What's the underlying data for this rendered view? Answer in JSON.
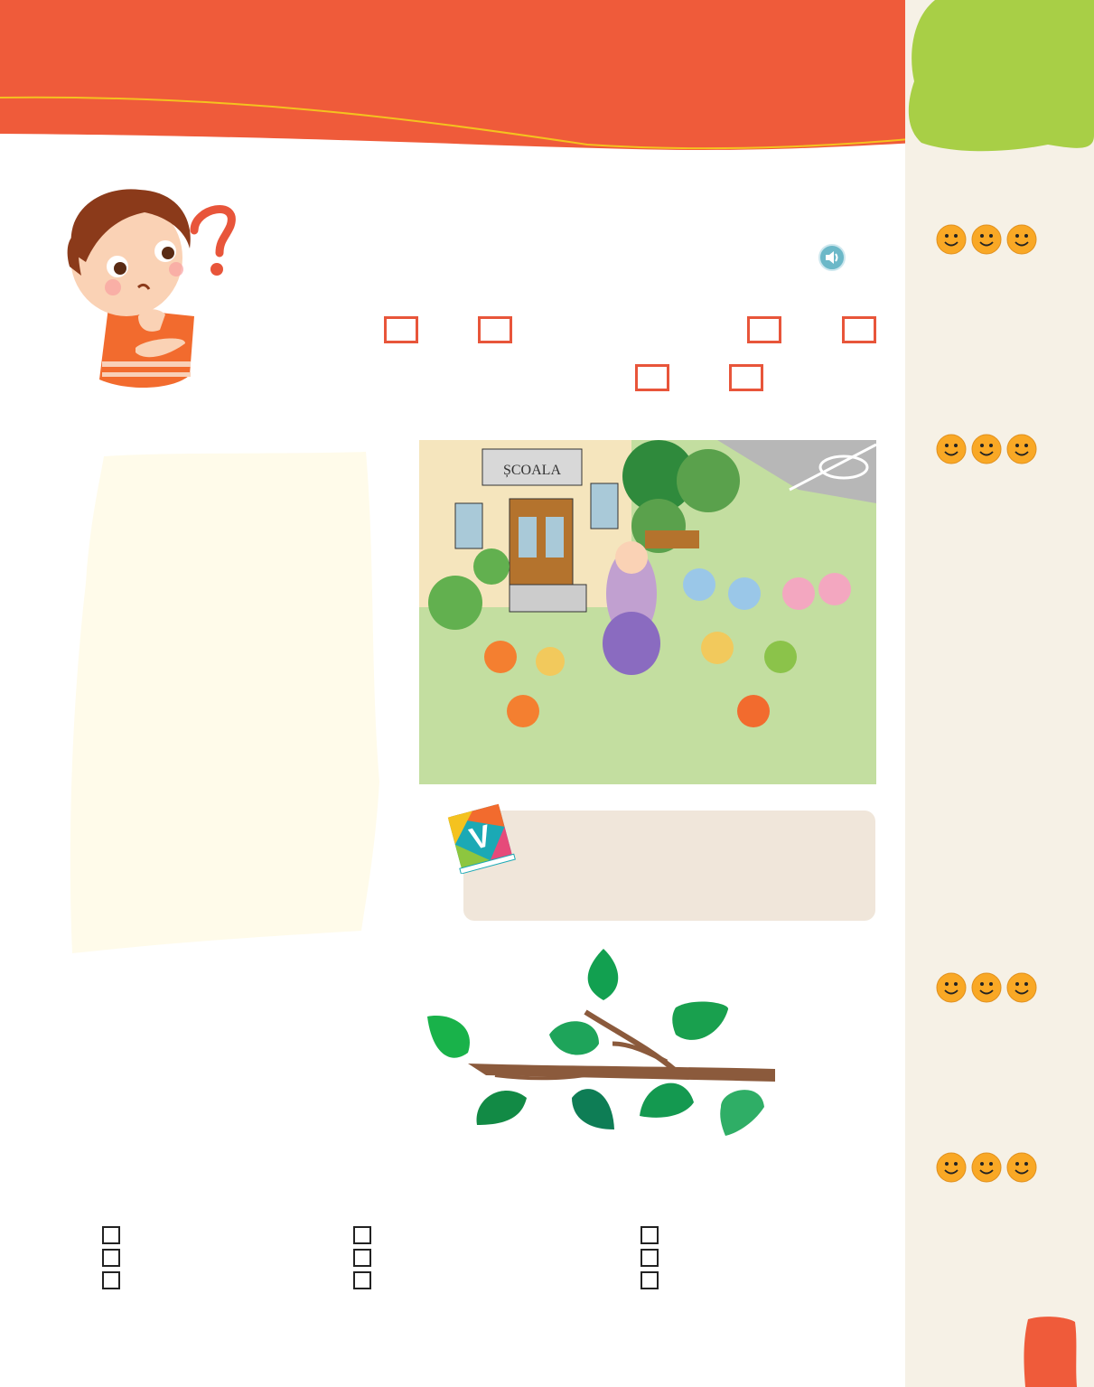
{
  "page": {
    "colors": {
      "header": "#ef5b3a",
      "header_line": "#f4c21f",
      "sidebar": "#f6f1e6",
      "leaf_blob": "#a8cf46",
      "checkbox_border": "#e8553a",
      "vocab_box": "#f0e6da",
      "note_area": "#fffbea",
      "page_tab": "#ef5b3a"
    }
  },
  "illustration": {
    "school_sign": "ȘCOALA"
  },
  "icons": {
    "thinking_boy": "thinking-boy-icon",
    "audio": "speaker-icon",
    "vocabulary": "vocabulary-book-icon",
    "smiley": "smiley-face-icon",
    "branch": "leafy-branch-icon"
  },
  "vocabulary_book": {
    "letter": "V"
  }
}
